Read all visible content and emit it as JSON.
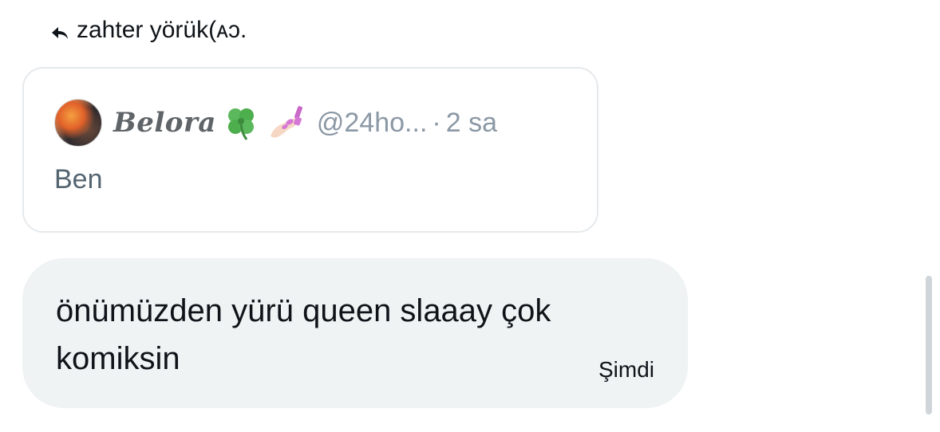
{
  "reply_header": {
    "icon": "reply-arrow-icon",
    "text": "zahter yörük(ᴀɔ."
  },
  "quoted_tweet": {
    "avatar": "avatar",
    "display_name": "Belora",
    "name_emojis": [
      "four-leaf-clover-icon",
      "nail-polish-icon"
    ],
    "handle": "@24ho...",
    "separator": "·",
    "time": "2 sa",
    "text": "Ben"
  },
  "message": {
    "text": "önümüzden yürü queen slaaay çok komiksin",
    "timestamp": "Şimdi",
    "bubble_color": "#eff3f4"
  },
  "colors": {
    "text_primary": "#0f1419",
    "text_secondary": "#8b98a5",
    "border": "#e6e9ec"
  }
}
